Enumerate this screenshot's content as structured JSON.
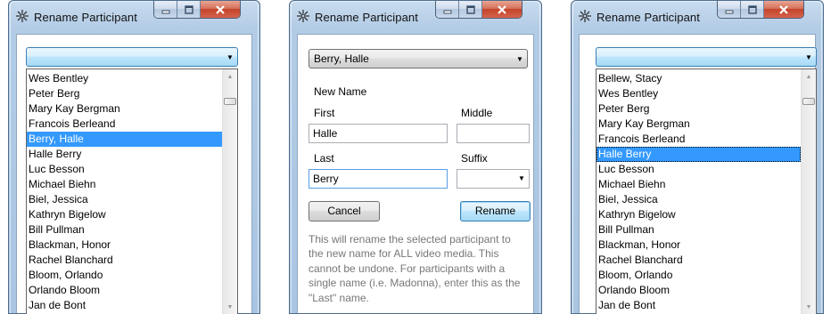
{
  "colors": {
    "frame": "#aac5e2",
    "selection": "#3399ff",
    "close": "#c4432b",
    "help_text": "#777777"
  },
  "icons": {
    "app": "gear-icon",
    "minimize": "minimize-icon",
    "maximize": "maximize-icon",
    "close": "close-icon",
    "dropdown": "chevron-down-icon"
  },
  "left": {
    "title": "Rename Participant",
    "combo_value": "",
    "items": [
      "Wes Bentley",
      "Peter Berg",
      "Mary Kay Bergman",
      "Francois Berleand",
      "Berry, Halle",
      "Halle Berry",
      "Luc Besson",
      "Michael Biehn",
      "Biel, Jessica",
      "Kathryn Bigelow",
      "Bill Pullman",
      "Blackman, Honor",
      "Rachel Blanchard",
      "Bloom, Orlando",
      "Orlando Bloom",
      "Jan de Bont"
    ],
    "selected_index": 4
  },
  "middle": {
    "title": "Rename Participant",
    "combo_value": "Berry, Halle",
    "new_name_label": "New Name",
    "first_label": "First",
    "middle_label": "Middle",
    "first_value": "Halle",
    "middle_value": "",
    "last_label": "Last",
    "suffix_label": "Suffix",
    "last_value": "Berry",
    "suffix_value": "",
    "cancel_label": "Cancel",
    "rename_label": "Rename",
    "help_lines": [
      "This will rename the selected participant to",
      "the new name for ALL video media. This",
      "cannot be undone. For participants with a",
      "single name (i.e. Madonna), enter this as the",
      "\"Last\" name."
    ]
  },
  "right": {
    "title": "Rename Participant",
    "combo_value": "",
    "items": [
      "Bellew, Stacy",
      "Wes Bentley",
      "Peter Berg",
      "Mary Kay Bergman",
      "Francois Berleand",
      "Halle Berry",
      "Luc Besson",
      "Michael Biehn",
      "Biel, Jessica",
      "Kathryn Bigelow",
      "Bill Pullman",
      "Blackman, Honor",
      "Rachel Blanchard",
      "Bloom, Orlando",
      "Orlando Bloom",
      "Jan de Bont"
    ],
    "selected_index": 5
  }
}
